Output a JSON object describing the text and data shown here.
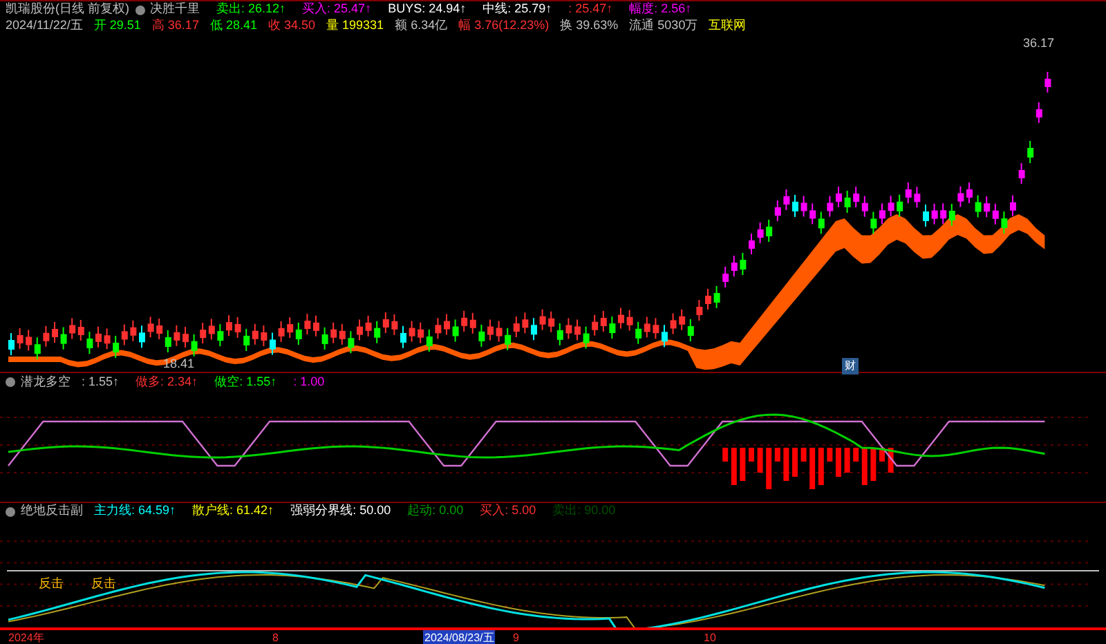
{
  "main_panel": {
    "title": "凯瑞股份(日线 前复权)",
    "indicator": "决胜千里",
    "indicator_values": [
      {
        "text": "卖出: 26.12↑",
        "color": "#00ff00"
      },
      {
        "text": "买入: 25.47↑",
        "color": "#ff00ff"
      },
      {
        "text": "BUYS: 24.94↑",
        "color": "#ffffff"
      },
      {
        "text": "中线: 25.79↑",
        "color": "#ffffff"
      },
      {
        "text": ": 25.47↑",
        "color": "#ff3030"
      },
      {
        "text": "幅度: 2.56↑",
        "color": "#ff00ff"
      }
    ],
    "quote": [
      {
        "text": "2024/11/22/五",
        "color": "#c0c0c0"
      },
      {
        "text": "开 29.51",
        "color": "#00ff00"
      },
      {
        "text": "高 36.17",
        "color": "#ff3030"
      },
      {
        "text": "低 28.41",
        "color": "#00ff00"
      },
      {
        "text": "收 34.50",
        "color": "#ff3030"
      },
      {
        "text": "量 199331",
        "color": "#ffff00"
      },
      {
        "text": "额 6.34亿",
        "color": "#c0c0c0"
      },
      {
        "text": "幅 3.76(12.23%)",
        "color": "#ff3030"
      },
      {
        "text": "换 39.63%",
        "color": "#c0c0c0"
      },
      {
        "text": "流通 5030万",
        "color": "#c0c0c0"
      },
      {
        "text": "互联网",
        "color": "#ffff00"
      }
    ],
    "high_label": "36.17",
    "low_label": "18.41",
    "badge": "财"
  },
  "signal_panel": {
    "title": "潜龙多空",
    "values": [
      {
        "text": ": 1.55↑",
        "color": "#c0c0c0"
      },
      {
        "text": "做多: 2.34↑",
        "color": "#ff3030"
      },
      {
        "text": "做空: 1.55↑",
        "color": "#00ff00"
      },
      {
        "text": ": 1.00",
        "color": "#ff00ff"
      }
    ]
  },
  "trend_panel": {
    "title": "绝地反击副",
    "values": [
      {
        "text": "主力线: 64.59↑",
        "color": "#00ffff"
      },
      {
        "text": "散户线: 61.42↑",
        "color": "#ffff00"
      },
      {
        "text": "强弱分界线: 50.00",
        "color": "#ffffff"
      },
      {
        "text": "起动: 0.00",
        "color": "#00a000"
      },
      {
        "text": "买入: 5.00",
        "color": "#ff3030"
      },
      {
        "text": "卖出: 90.00",
        "color": "#005000"
      }
    ],
    "signals": [
      "反击",
      "反击"
    ]
  },
  "time_axis": [
    {
      "text": "2024年",
      "selected": false
    },
    {
      "text": "8",
      "selected": false
    },
    {
      "text": "2024/08/23/五",
      "selected": true
    },
    {
      "text": "9",
      "selected": false
    },
    {
      "text": "10",
      "selected": false
    }
  ]
}
